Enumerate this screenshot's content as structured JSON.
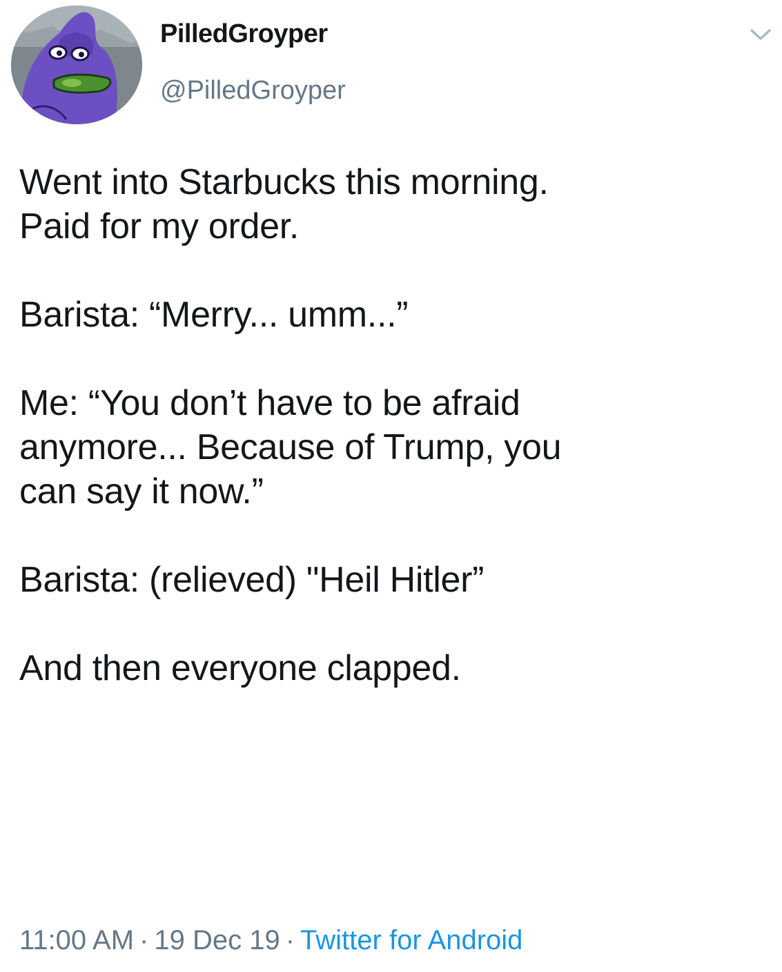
{
  "header": {
    "display_name": "PilledGroyper",
    "handle": "@PilledGroyper",
    "avatar_icon": "purple-frog-avatar-icon",
    "menu_icon": "chevron-down-icon"
  },
  "tweet": {
    "paragraphs": [
      "Went into Starbucks this morning.\nPaid for my order.",
      "Barista: “Merry... umm...”",
      "Me: “You don’t have to be afraid\nanymore... Because of Trump, you\ncan say it now.”",
      "Barista: (relieved) \"Heil Hitler”",
      "And then everyone clapped."
    ]
  },
  "meta": {
    "time": "11:00 AM",
    "separator": "·",
    "date": "19 Dec 19",
    "source": "Twitter for Android"
  },
  "colors": {
    "text": "#14171a",
    "secondary": "#657786",
    "link": "#1b95e0"
  }
}
